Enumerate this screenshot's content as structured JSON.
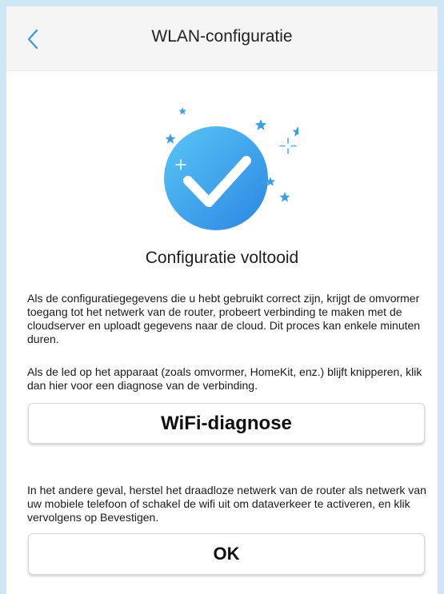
{
  "header": {
    "title": "WLAN-configuratie",
    "back_icon": "chevron-left-icon"
  },
  "status": {
    "icon": "check-circle-icon",
    "heading": "Configuratie voltooid"
  },
  "content": {
    "paragraph1": "Als de configuratiegegevens die u hebt gebruikt correct zijn, krijgt de omvormer toegang tot het netwerk van de router, probeert verbinding te maken met de cloudserver en uploadt gegevens naar de cloud. Dit proces kan enkele minuten duren.",
    "paragraph2": "Als de led op het apparaat (zoals omvormer, HomeKit, enz.) blijft knipperen, klik dan hier voor een diagnose van de verbinding.",
    "diagnose_button": "WiFi-diagnose",
    "paragraph3": "In het andere geval, herstel het draadloze netwerk van de router als netwerk van uw mobiele telefoon of schakel de wifi uit om dataverkeer te activeren, en klik vervolgens op Bevestigen.",
    "ok_button": "OK"
  },
  "colors": {
    "accent": "#3a95e3",
    "check_gradient_start": "#54c1f4",
    "check_gradient_end": "#2f8ee6",
    "star": "#3a9de6"
  }
}
